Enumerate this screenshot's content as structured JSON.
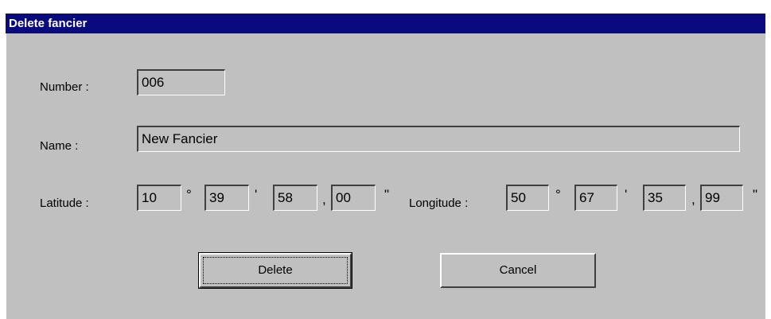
{
  "window": {
    "title": "Delete fancier"
  },
  "labels": {
    "number": "Number :",
    "name": "Name :",
    "latitude": "Latitude :",
    "longitude": "Longitude :"
  },
  "fields": {
    "number": "006",
    "name": "New Fancier",
    "lat_deg": "10",
    "lat_min": "39",
    "lat_sec": "58",
    "lat_hund": "00",
    "lon_deg": "50",
    "lon_min": "67",
    "lon_sec": "35",
    "lon_hund": "99"
  },
  "symbols": {
    "degree": "°",
    "minute": "'",
    "comma": ",",
    "second": "\""
  },
  "buttons": {
    "delete": "Delete",
    "cancel": "Cancel"
  }
}
